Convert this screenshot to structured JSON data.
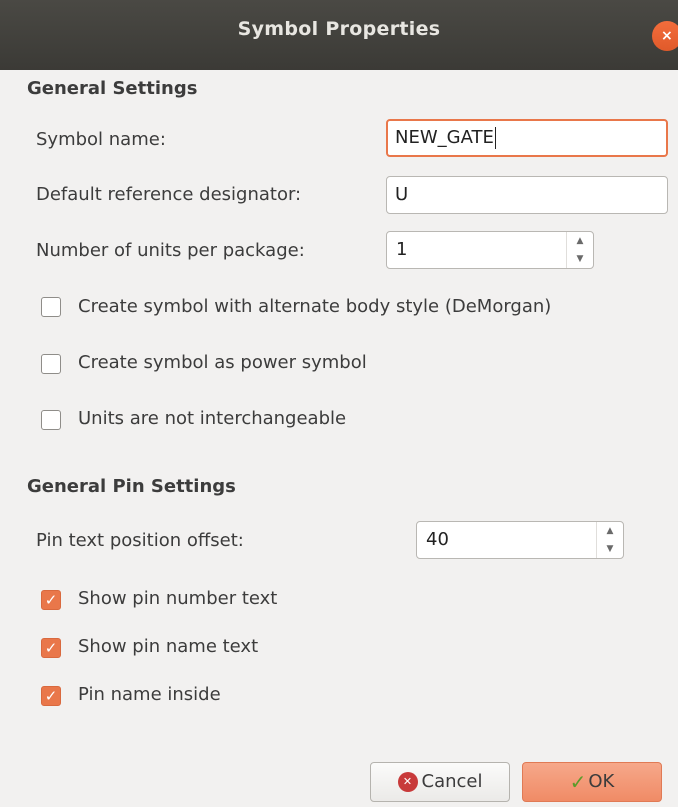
{
  "window": {
    "title": "Symbol Properties",
    "close_glyph": "×"
  },
  "general": {
    "heading": "General Settings",
    "symbol_name_label": "Symbol name:",
    "symbol_name_value": "NEW_GATE",
    "ref_label": "Default reference designator:",
    "ref_value": "U",
    "units_label": "Number of units per package:",
    "units_value": "1",
    "demorgan_label": "Create symbol with alternate body style (DeMorgan)",
    "power_label": "Create symbol as power symbol",
    "interchange_label": "Units are not interchangeable"
  },
  "pins": {
    "heading": "General Pin Settings",
    "offset_label": "Pin text position offset:",
    "offset_value": "40",
    "show_number_label": "Show pin number text",
    "show_name_label": "Show pin name text",
    "name_inside_label": "Pin name inside"
  },
  "buttons": {
    "cancel": "Cancel",
    "ok": "OK"
  },
  "colors": {
    "accent": "#e9774a",
    "titlebar": "#3b3a36",
    "background": "#f2f1f0"
  }
}
